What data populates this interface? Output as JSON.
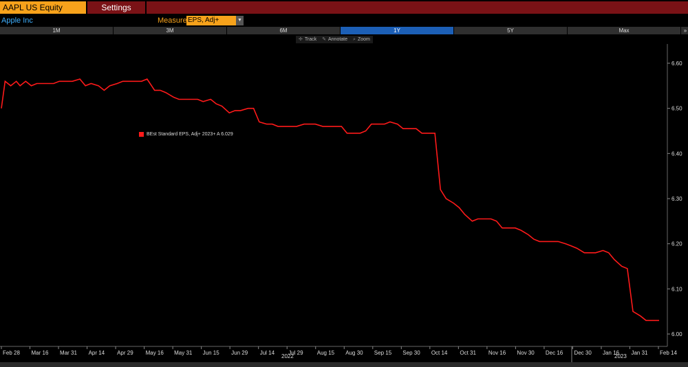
{
  "header": {
    "ticker_label": "AAPL US Equity",
    "settings_label": "Settings"
  },
  "security": {
    "company_name": "Apple Inc",
    "measure_label": "Measure",
    "measure_value": "EPS, Adj+"
  },
  "ranges": {
    "buttons": [
      "1M",
      "3M",
      "6M",
      "1Y",
      "5Y",
      "Max"
    ],
    "active": "1Y",
    "close_label": "»"
  },
  "tools": {
    "track": "Track",
    "annotate": "Annotate",
    "zoom": "Zoom"
  },
  "legend": {
    "label": "BEst Standard EPS, Adj+ 2023+ A 6.029",
    "color": "#ff1a1a"
  },
  "years": {
    "year1": "2022",
    "year2": "2023"
  },
  "chart_data": {
    "type": "line",
    "series": [
      {
        "name": "BEst Standard EPS, Adj+ 2023+ A",
        "color": "#ff1a1a",
        "x": [
          0,
          2,
          5,
          8,
          10,
          13,
          16,
          19,
          22,
          25,
          28,
          31,
          35,
          38,
          42,
          45,
          48,
          52,
          55,
          58,
          62,
          65,
          68,
          72,
          75,
          78,
          82,
          85,
          88,
          92,
          95,
          98,
          102,
          105,
          108,
          112,
          115,
          118,
          122,
          125,
          128,
          132,
          135,
          138,
          142,
          145,
          148,
          152,
          155,
          158,
          162,
          165,
          168,
          172,
          175,
          178,
          182,
          185,
          188,
          192,
          195,
          198,
          202,
          205,
          208,
          212,
          215,
          218,
          222,
          225,
          228,
          232,
          235,
          238,
          242,
          245,
          248,
          252,
          255,
          258,
          262,
          265,
          268,
          272,
          275,
          278,
          282,
          285,
          288,
          292,
          295,
          298,
          302,
          305,
          308,
          312,
          315,
          318,
          322,
          325,
          328,
          332,
          335,
          338,
          342,
          345,
          348,
          352
        ],
        "values": [
          6.5,
          6.56,
          6.55,
          6.56,
          6.55,
          6.56,
          6.55,
          6.555,
          6.555,
          6.555,
          6.555,
          6.56,
          6.56,
          6.56,
          6.565,
          6.55,
          6.555,
          6.55,
          6.54,
          6.55,
          6.555,
          6.56,
          6.56,
          6.56,
          6.56,
          6.565,
          6.54,
          6.54,
          6.535,
          6.525,
          6.52,
          6.52,
          6.52,
          6.52,
          6.515,
          6.52,
          6.51,
          6.505,
          6.49,
          6.495,
          6.495,
          6.5,
          6.5,
          6.47,
          6.465,
          6.465,
          6.46,
          6.46,
          6.46,
          6.46,
          6.465,
          6.465,
          6.465,
          6.46,
          6.46,
          6.46,
          6.46,
          6.445,
          6.445,
          6.445,
          6.45,
          6.465,
          6.465,
          6.465,
          6.47,
          6.465,
          6.455,
          6.455,
          6.455,
          6.445,
          6.445,
          6.445,
          6.32,
          6.3,
          6.29,
          6.28,
          6.265,
          6.25,
          6.255,
          6.255,
          6.255,
          6.25,
          6.235,
          6.235,
          6.235,
          6.23,
          6.22,
          6.21,
          6.205,
          6.205,
          6.205,
          6.205,
          6.2,
          6.195,
          6.19,
          6.18,
          6.18,
          6.18,
          6.185,
          6.18,
          6.165,
          6.15,
          6.145,
          6.05,
          6.04,
          6.03,
          6.03,
          6.03
        ]
      }
    ],
    "x_tick_labels": [
      "Feb 28",
      "Mar 16",
      "Mar 31",
      "Apr 14",
      "Apr 29",
      "May 16",
      "May 31",
      "Jun 15",
      "Jun 29",
      "Jul 14",
      "Jul 29",
      "Aug 15",
      "Aug 30",
      "Sep 15",
      "Sep 30",
      "Oct 14",
      "Oct 31",
      "Nov 16",
      "Nov 30",
      "Dec 16",
      "Dec 30",
      "Jan 16",
      "Jan 31",
      "Feb 14"
    ],
    "y_ticks": [
      6.0,
      6.1,
      6.2,
      6.3,
      6.4,
      6.5,
      6.6
    ],
    "y_tick_labels": [
      "6.00",
      "6.10",
      "6.20",
      "6.30",
      "6.40",
      "6.50",
      "6.60"
    ],
    "ylim": [
      6.0,
      6.6
    ],
    "legend_position": "upper-left"
  }
}
